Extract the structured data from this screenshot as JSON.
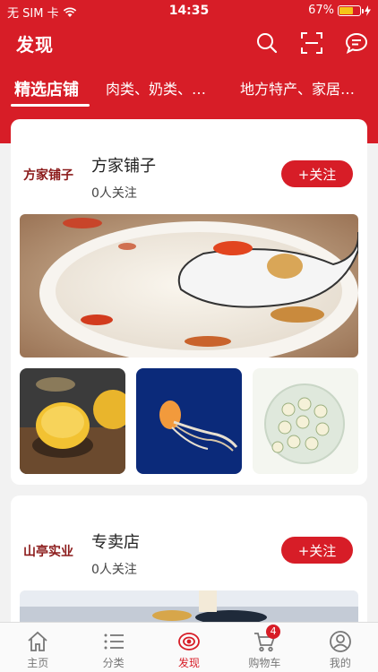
{
  "status_bar": {
    "carrier": "无 SIM 卡",
    "time": "14:35",
    "battery_percent": "67%",
    "battery_level": 0.67
  },
  "header": {
    "title": "发现",
    "icons": [
      "search-icon",
      "scan-icon",
      "message-icon"
    ],
    "accent_color": "#d71d27"
  },
  "tabs": [
    {
      "label": "精选店铺",
      "active": true
    },
    {
      "label": "肉类、奶类、…",
      "active": false
    },
    {
      "label": "地方特产、家居…",
      "active": false
    }
  ],
  "shops": [
    {
      "logo_text": "方家铺子",
      "name": "方家铺子",
      "followers": "0人关注",
      "follow_label": "+关注"
    },
    {
      "logo_text": "山亭实业",
      "name": "专卖店",
      "followers": "0人关注",
      "follow_label": "+关注"
    }
  ],
  "bottom_nav": [
    {
      "label": "主页",
      "icon": "home-icon",
      "active": false
    },
    {
      "label": "分类",
      "icon": "list-icon",
      "active": false
    },
    {
      "label": "发现",
      "icon": "discover-icon",
      "active": true
    },
    {
      "label": "购物车",
      "icon": "cart-icon",
      "active": false,
      "badge": "4"
    },
    {
      "label": "我的",
      "icon": "profile-icon",
      "active": false
    }
  ]
}
